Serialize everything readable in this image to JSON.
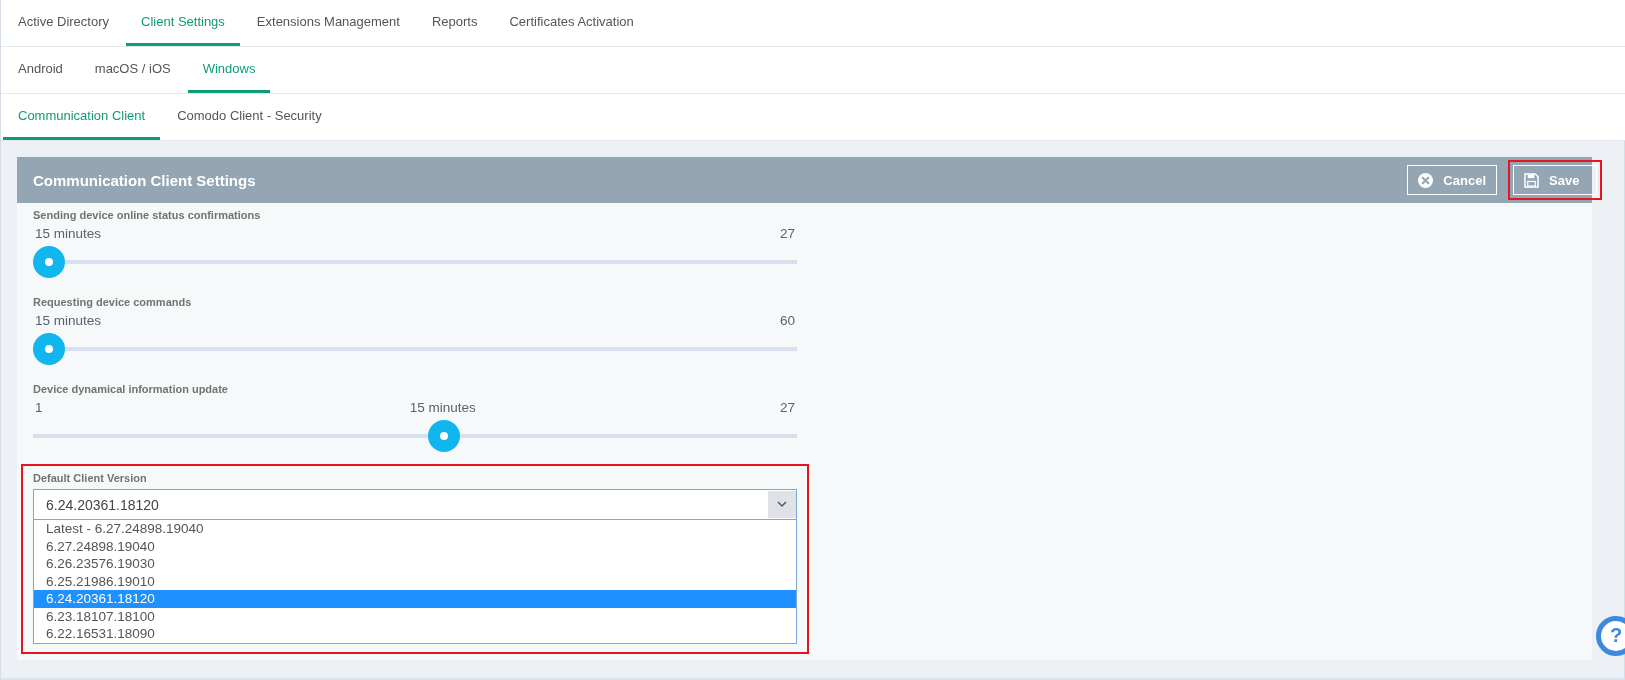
{
  "tabs": [
    {
      "label": "Active Directory",
      "selected": false
    },
    {
      "label": "Client Settings",
      "selected": true
    },
    {
      "label": "Extensions Management",
      "selected": false
    },
    {
      "label": "Reports",
      "selected": false
    },
    {
      "label": "Certificates Activation",
      "selected": false
    }
  ],
  "platform_tabs": [
    {
      "label": "Android",
      "selected": false
    },
    {
      "label": "macOS / iOS",
      "selected": false
    },
    {
      "label": "Windows",
      "selected": true
    }
  ],
  "client_tabs": [
    {
      "label": "Communication Client",
      "selected": true
    },
    {
      "label": "Comodo Client - Security",
      "selected": false
    }
  ],
  "panel": {
    "title": "Communication Client Settings",
    "buttons": [
      {
        "label": "Cancel",
        "kind": "cancel",
        "highlighted": false
      },
      {
        "label": "Save",
        "kind": "save",
        "highlighted": true
      }
    ]
  },
  "sliders": [
    {
      "label": "Sending device online status confirmations",
      "value_label": "15 minutes",
      "max_label": "27",
      "level": 0
    },
    {
      "label": "Requesting device commands",
      "value_label": "15 minutes",
      "max_label": "60",
      "level": 0
    },
    {
      "label": "Device dynamical information update",
      "min_label": "1",
      "value_label": "15 minutes",
      "max_label": "27",
      "level": 0.54
    }
  ],
  "client_version": {
    "label": "Default Client Version",
    "value": "6.24.20361.18120",
    "highlighted": true,
    "expanded": true,
    "options": [
      {
        "label": "Latest - 6.27.24898.19040",
        "selected": false
      },
      {
        "label": "6.27.24898.19040",
        "selected": false
      },
      {
        "label": "6.26.23576.19030",
        "selected": false
      },
      {
        "label": "6.25.21986.19010",
        "selected": false
      },
      {
        "label": "6.24.20361.18120",
        "selected": true
      },
      {
        "label": "6.23.18107.18100",
        "selected": false
      },
      {
        "label": "6.22.16531.18090",
        "selected": false
      }
    ]
  },
  "help": {
    "label": "?"
  }
}
